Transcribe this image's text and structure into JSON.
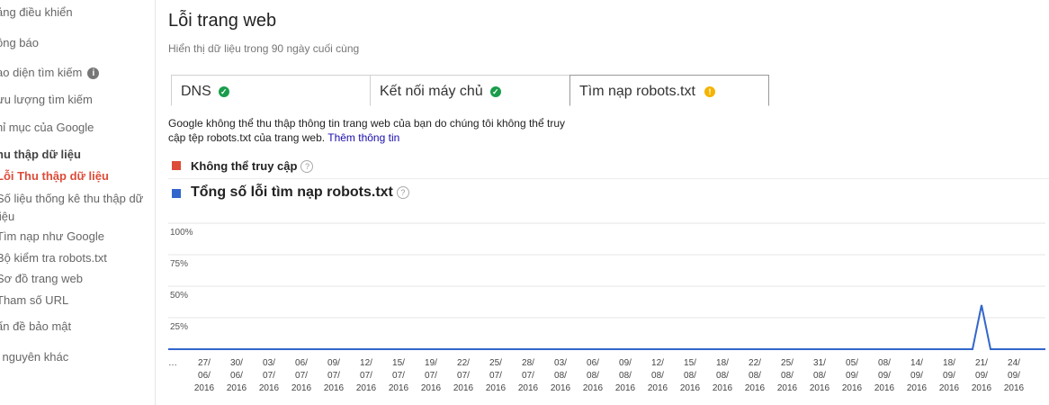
{
  "sidebar": {
    "items": [
      {
        "label": "ảng điều khiển",
        "type": "item"
      },
      {
        "label": "ông báo",
        "type": "item"
      },
      {
        "label": "ao diện tìm kiếm",
        "type": "item",
        "icon": "info-icon"
      },
      {
        "label": "ưu lượng tìm kiếm",
        "type": "item"
      },
      {
        "label": "hỉ mục của Google",
        "type": "item"
      },
      {
        "label": "hu thập dữ liệu",
        "type": "section"
      },
      {
        "label": "Lỗi Thu thập dữ liệu",
        "type": "active"
      },
      {
        "label": "Số liệu thống kê thu thập dữ liệu",
        "type": "item"
      },
      {
        "label": "Tìm nạp như Google",
        "type": "item"
      },
      {
        "label": "Bộ kiểm tra robots.txt",
        "type": "item"
      },
      {
        "label": "Sơ đồ trang web",
        "type": "item"
      },
      {
        "label": "Tham số URL",
        "type": "item"
      },
      {
        "label": "ấn đề bảo mật",
        "type": "item"
      },
      {
        "label": "i nguyên khác",
        "type": "item"
      }
    ]
  },
  "header": {
    "title": "Lỗi trang web",
    "subtitle": "Hiển thị dữ liệu trong 90 ngày cuối cùng"
  },
  "tabs": [
    {
      "label": "DNS",
      "status": "ok",
      "icon": "check-icon"
    },
    {
      "label": "Kết nối máy chủ",
      "status": "ok",
      "icon": "check-icon"
    },
    {
      "label": "Tìm nạp robots.txt",
      "status": "warning",
      "icon": "warning-icon"
    }
  ],
  "message": {
    "text": "Google không thể thu thập thông tin trang web của bạn do chúng tôi không thể truy cập tệp robots.txt của trang web.",
    "link": "Thêm thông tin"
  },
  "legend": [
    {
      "label": "Không thể truy cập",
      "color": "#dd4b39"
    },
    {
      "label": "Tổng số lỗi tìm nạp robots.txt",
      "color": "#3366cc"
    }
  ],
  "chart_data": {
    "type": "line",
    "y_tick_labels": [
      "100%",
      "75%",
      "50%",
      "25%"
    ],
    "ylim": [
      0,
      100
    ],
    "x_tick_labels": [
      "…",
      "27/\n06/\n2016",
      "30/\n06/\n2016",
      "03/\n07/\n2016",
      "06/\n07/\n2016",
      "09/\n07/\n2016",
      "12/\n07/\n2016",
      "15/\n07/\n2016",
      "19/\n07/\n2016",
      "22/\n07/\n2016",
      "25/\n07/\n2016",
      "28/\n07/\n2016",
      "03/\n08/\n2016",
      "06/\n08/\n2016",
      "09/\n08/\n2016",
      "12/\n08/\n2016",
      "15/\n08/\n2016",
      "18/\n08/\n2016",
      "22/\n08/\n2016",
      "25/\n08/\n2016",
      "31/\n08/\n2016",
      "05/\n09/\n2016",
      "08/\n09/\n2016",
      "14/\n09/\n2016",
      "18/\n09/\n2016",
      "21/\n09/\n2016",
      "24/\n09/\n2016"
    ],
    "series": [
      {
        "name": "Tổng số lỗi tìm nạp robots.txt",
        "color": "#3366cc",
        "values": [
          0,
          0,
          0,
          0,
          0,
          0,
          0,
          0,
          0,
          0,
          0,
          0,
          0,
          0,
          0,
          0,
          0,
          0,
          0,
          0,
          0,
          0,
          0,
          0,
          0,
          35,
          0
        ]
      }
    ],
    "grid": true,
    "legend": "top"
  }
}
